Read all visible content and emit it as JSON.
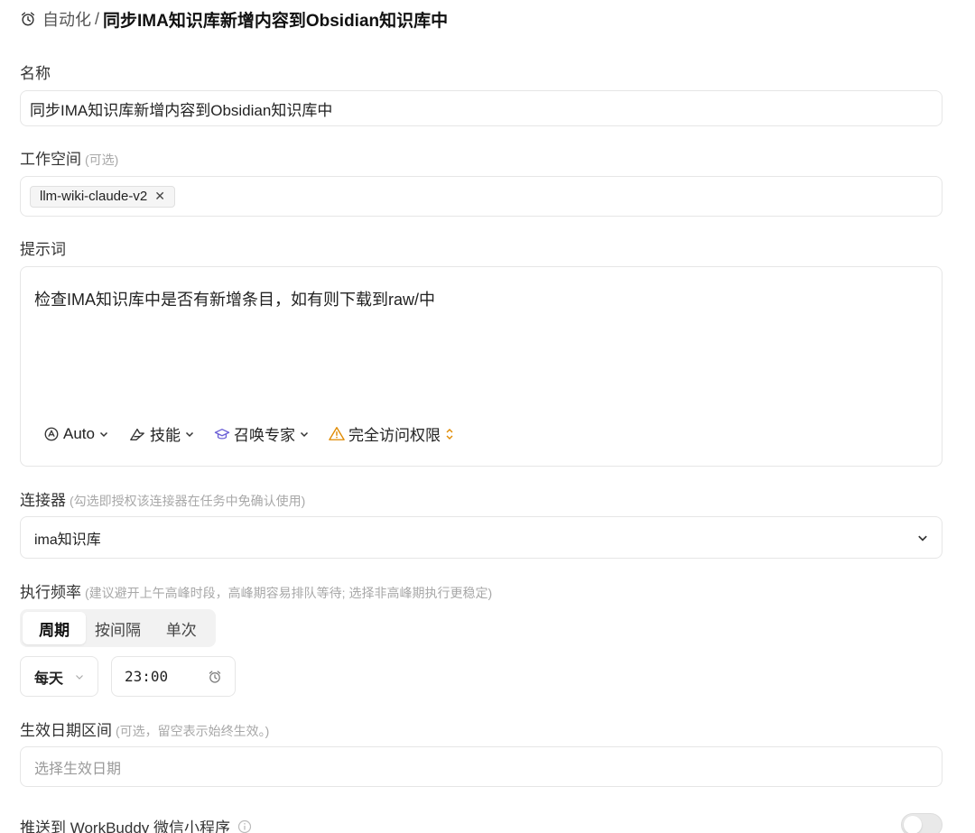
{
  "header": {
    "breadcrumb_root": "自动化",
    "separator": "/",
    "title": "同步IMA知识库新增内容到Obsidian知识库中"
  },
  "name": {
    "label": "名称",
    "value": "同步IMA知识库新增内容到Obsidian知识库中"
  },
  "workspace": {
    "label": "工作空间",
    "hint": "(可选)",
    "tag": "llm-wiki-claude-v2",
    "remove_glyph": "✕"
  },
  "prompt": {
    "label": "提示词",
    "value": "检查IMA知识库中是否有新增条目，如有则下载到raw/中",
    "tools": {
      "model": "Auto",
      "skills": "技能",
      "expert": "召唤专家",
      "access": "完全访问权限"
    }
  },
  "connector": {
    "label": "连接器",
    "hint": "(勾选即授权该连接器在任务中免确认使用)",
    "value": "ima知识库"
  },
  "frequency": {
    "label": "执行频率",
    "hint": "(建议避开上午高峰时段，高峰期容易排队等待; 选择非高峰期执行更稳定)",
    "segments": [
      "周期",
      "按间隔",
      "单次"
    ],
    "active_segment": "周期",
    "period_value": "每天",
    "time_value": "23:00"
  },
  "date_range": {
    "label": "生效日期区间",
    "hint": "(可选，留空表示始终生效。)",
    "placeholder": "选择生效日期"
  },
  "push": {
    "label": "推送到 WorkBuddy 微信小程序",
    "enabled": false
  },
  "colors": {
    "warning": "#e08a00",
    "expert_icon": "#6b5fd6",
    "border": "#e6e6e6"
  }
}
